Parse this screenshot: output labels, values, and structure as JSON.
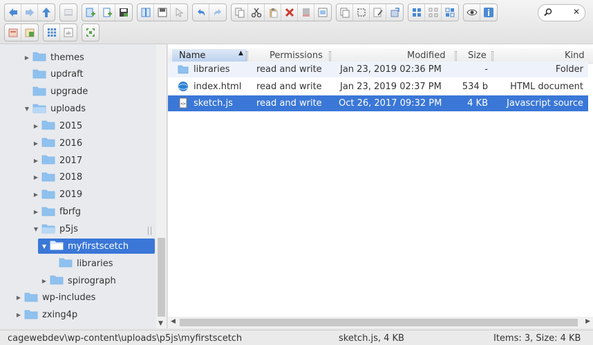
{
  "toolbar": {
    "search_placeholder": "",
    "row1_groups": [
      [
        "back-icon",
        "forward-icon",
        "up-icon"
      ],
      [
        "reload-icon"
      ],
      [
        "new-folder-icon",
        "new-file-icon",
        "save-icon"
      ],
      [
        "open-icon",
        "download-icon",
        "select-icon"
      ],
      [
        "undo-icon",
        "redo-icon"
      ],
      [
        "copy-icon",
        "cut-icon",
        "paste-icon",
        "delete-icon",
        "empty-icon",
        "rename-icon"
      ],
      [
        "duplicate-icon",
        "select-all-icon",
        "edit-icon",
        "resize-icon"
      ],
      [
        "icons-view-icon",
        "small-icons-view-icon",
        "list-view-icon"
      ],
      [
        "preview-icon",
        "info-icon"
      ]
    ],
    "row2_groups": [
      [
        "archive-icon",
        "extract-icon"
      ],
      [
        "grid-icon",
        "text-icon"
      ],
      [
        "fullscreen-icon"
      ]
    ]
  },
  "tree": {
    "items": [
      {
        "label": "themes",
        "depth": 1,
        "expandable": true,
        "expanded": false
      },
      {
        "label": "updraft",
        "depth": 1,
        "expandable": false,
        "expanded": false
      },
      {
        "label": "upgrade",
        "depth": 1,
        "expandable": false,
        "expanded": false
      },
      {
        "label": "uploads",
        "depth": 1,
        "expandable": true,
        "expanded": true
      },
      {
        "label": "2015",
        "depth": 2,
        "expandable": true,
        "expanded": false
      },
      {
        "label": "2016",
        "depth": 2,
        "expandable": true,
        "expanded": false
      },
      {
        "label": "2017",
        "depth": 2,
        "expandable": true,
        "expanded": false
      },
      {
        "label": "2018",
        "depth": 2,
        "expandable": true,
        "expanded": false
      },
      {
        "label": "2019",
        "depth": 2,
        "expandable": true,
        "expanded": false
      },
      {
        "label": "fbrfg",
        "depth": 2,
        "expandable": true,
        "expanded": false
      },
      {
        "label": "p5js",
        "depth": 2,
        "expandable": true,
        "expanded": true
      },
      {
        "label": "myfirstscetch",
        "depth": 3,
        "expandable": true,
        "expanded": true,
        "selected": true
      },
      {
        "label": "libraries",
        "depth": 4,
        "expandable": false,
        "expanded": false
      },
      {
        "label": "spirograph",
        "depth": 3,
        "expandable": true,
        "expanded": false
      },
      {
        "label": "wp-includes",
        "depth": 0,
        "expandable": true,
        "expanded": false
      },
      {
        "label": "zxing4p",
        "depth": 0,
        "expandable": true,
        "expanded": false
      }
    ]
  },
  "columns": {
    "name": "Name",
    "permissions": "Permissions",
    "modified": "Modified",
    "size": "Size",
    "kind": "Kind"
  },
  "files": [
    {
      "name": "libraries",
      "permissions": "read and write",
      "modified": "Jan 23, 2019 02:36 PM",
      "size": "-",
      "kind": "Folder",
      "icon": "folder-icon"
    },
    {
      "name": "index.html",
      "permissions": "read and write",
      "modified": "Jan 23, 2019 02:37 PM",
      "size": "534 b",
      "kind": "HTML document",
      "icon": "html-file-icon"
    },
    {
      "name": "sketch.js",
      "permissions": "read and write",
      "modified": "Oct 26, 2017 09:32 PM",
      "size": "4 KB",
      "kind": "Javascript source",
      "icon": "js-file-icon",
      "selected": true
    }
  ],
  "status": {
    "path": "cagewebdev\\wp-content\\uploads\\p5js\\myfirstscetch",
    "selection": "sketch.js, 4 KB",
    "items": "Items: 3, Size: 4 KB"
  },
  "colors": {
    "selection": "#3a77d7",
    "folder": "#8fc1ef",
    "toolbar_icon": "#4a8ad4"
  }
}
